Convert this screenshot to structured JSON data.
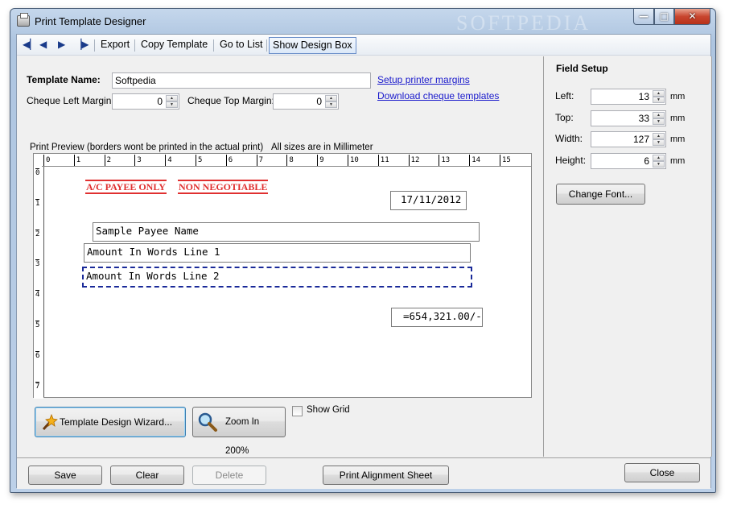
{
  "window": {
    "title": "Print Template Designer",
    "watermark": "SOFTPEDIA",
    "controls": {
      "minimize": "—",
      "maximize": "□",
      "close": "✕"
    }
  },
  "toolbar": {
    "nav": [
      "◀▏",
      "◀",
      "▶",
      "▕▶"
    ],
    "export": "Export",
    "copy_template": "Copy Template",
    "go_to_list": "Go to List",
    "show_design_box": "Show Design Box"
  },
  "form": {
    "template_name_label": "Template Name:",
    "template_name_value": "Softpedia",
    "left_margin_label": "Cheque Left Margin:",
    "left_margin_value": "0",
    "top_margin_label": "Cheque Top Margin:",
    "top_margin_value": "0",
    "setup_printer_link": "Setup printer margins",
    "download_link": "Download cheque templates"
  },
  "preview": {
    "caption": "Print Preview (borders wont be printed in the actual print)",
    "units_note": "All sizes are in Millimeter",
    "h_ticks": [
      "0",
      "1",
      "2",
      "3",
      "4",
      "5",
      "6",
      "7",
      "8",
      "9",
      "10",
      "11",
      "12",
      "13",
      "14",
      "15"
    ],
    "v_ticks": [
      "0",
      "1",
      "2",
      "3",
      "4",
      "5",
      "6",
      "7"
    ],
    "stamp_payee": "A/C PAYEE ONLY",
    "stamp_negotiable": "NON NEGOTIABLE",
    "date": "17/11/2012",
    "payee": "Sample Payee Name",
    "words1": "Amount In Words Line 1",
    "words2": "Amount In Words Line 2",
    "amount": "=654,321.00/-"
  },
  "actions": {
    "wizard": "Template Design Wizard...",
    "zoom": "Zoom In 200%",
    "show_grid": "Show Grid"
  },
  "field_setup": {
    "title": "Field Setup",
    "left_label": "Left:",
    "left_value": "13",
    "top_label": "Top:",
    "top_value": "33",
    "width_label": "Width:",
    "width_value": "127",
    "height_label": "Height:",
    "height_value": "6",
    "unit": "mm",
    "change_font": "Change Font..."
  },
  "bottom": {
    "save": "Save",
    "clear": "Clear",
    "delete": "Delete",
    "print_alignment": "Print Alignment Sheet",
    "close": "Close"
  }
}
